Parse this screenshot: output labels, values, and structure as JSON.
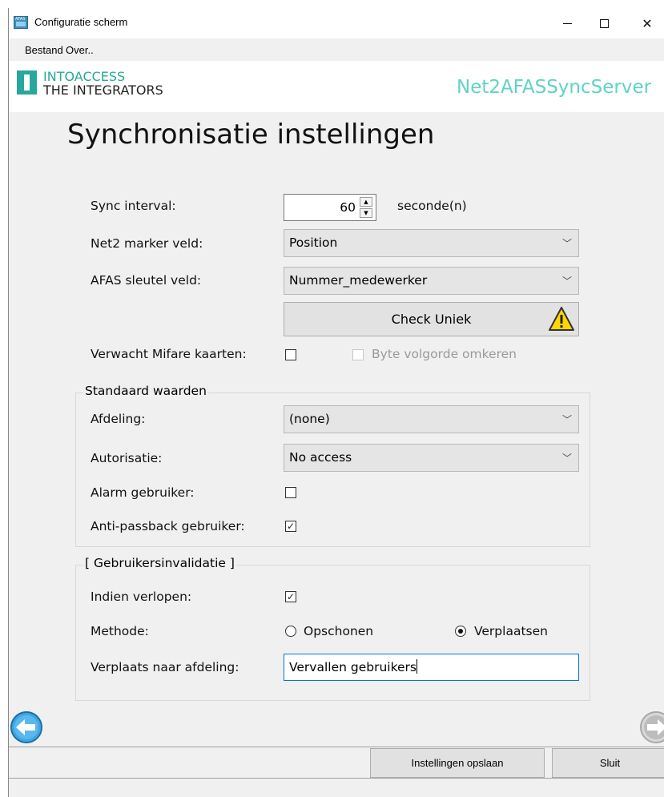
{
  "window": {
    "title": "Configuratie scherm",
    "icon_text": "AFAS"
  },
  "menu": {
    "bestand": "Bestand",
    "over": "Over.."
  },
  "brand": {
    "line1": "INTOACCESS",
    "line2": "THE INTEGRATORS",
    "product": "Net2AFASSyncServer"
  },
  "heading": "Synchronisatie instellingen",
  "sync": {
    "label": "Sync interval:",
    "value": "60",
    "unit": "seconde(n)"
  },
  "marker": {
    "label": "Net2 marker veld:",
    "value": "Position"
  },
  "afas_key": {
    "label": "AFAS sleutel veld:",
    "value": "Nummer_medewerker"
  },
  "check_button": "Check Uniek",
  "mifare": {
    "label": "Verwacht Mifare kaarten:",
    "checked": false,
    "byte_label": "Byte volgorde omkeren",
    "byte_checked": false
  },
  "defaults": {
    "title": "Standaard waarden",
    "afdeling_label": "Afdeling:",
    "afdeling_value": "(none)",
    "autorisatie_label": "Autorisatie:",
    "autorisatie_value": "No access",
    "alarm_label": "Alarm gebruiker:",
    "alarm_checked": false,
    "antipass_label": "Anti-passback gebruiker:",
    "antipass_checked": true
  },
  "invalidation": {
    "title": "[ Gebruikersinvalidatie ]",
    "expired_label": "Indien verlopen:",
    "expired_checked": true,
    "method_label": "Methode:",
    "option_clean": "Opschonen",
    "option_move": "Verplaatsen",
    "selected": "Verplaatsen",
    "move_label": "Verplaats naar afdeling:",
    "move_value": "Vervallen gebruikers"
  },
  "buttons": {
    "save": "Instellingen opslaan",
    "close": "Sluit"
  },
  "colors": {
    "accent": "#26a89a",
    "product": "#5fd3c5",
    "nav": "#3fa7e0"
  }
}
